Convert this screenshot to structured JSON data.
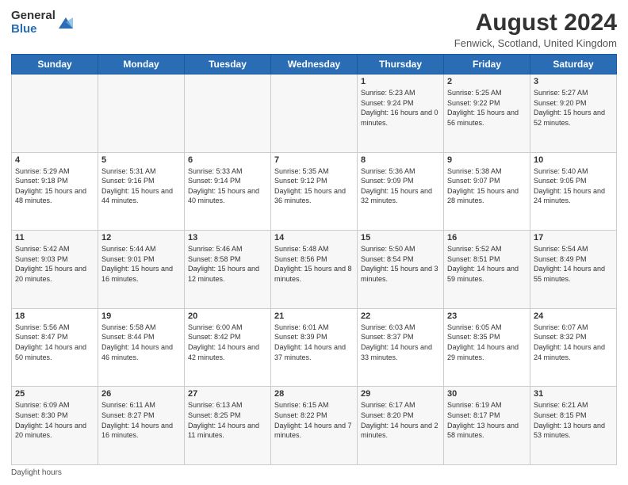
{
  "header": {
    "logo_general": "General",
    "logo_blue": "Blue",
    "title": "August 2024",
    "subtitle": "Fenwick, Scotland, United Kingdom"
  },
  "days_of_week": [
    "Sunday",
    "Monday",
    "Tuesday",
    "Wednesday",
    "Thursday",
    "Friday",
    "Saturday"
  ],
  "weeks": [
    [
      {
        "day": "",
        "info": ""
      },
      {
        "day": "",
        "info": ""
      },
      {
        "day": "",
        "info": ""
      },
      {
        "day": "",
        "info": ""
      },
      {
        "day": "1",
        "info": "Sunrise: 5:23 AM\nSunset: 9:24 PM\nDaylight: 16 hours\nand 0 minutes."
      },
      {
        "day": "2",
        "info": "Sunrise: 5:25 AM\nSunset: 9:22 PM\nDaylight: 15 hours\nand 56 minutes."
      },
      {
        "day": "3",
        "info": "Sunrise: 5:27 AM\nSunset: 9:20 PM\nDaylight: 15 hours\nand 52 minutes."
      }
    ],
    [
      {
        "day": "4",
        "info": "Sunrise: 5:29 AM\nSunset: 9:18 PM\nDaylight: 15 hours\nand 48 minutes."
      },
      {
        "day": "5",
        "info": "Sunrise: 5:31 AM\nSunset: 9:16 PM\nDaylight: 15 hours\nand 44 minutes."
      },
      {
        "day": "6",
        "info": "Sunrise: 5:33 AM\nSunset: 9:14 PM\nDaylight: 15 hours\nand 40 minutes."
      },
      {
        "day": "7",
        "info": "Sunrise: 5:35 AM\nSunset: 9:12 PM\nDaylight: 15 hours\nand 36 minutes."
      },
      {
        "day": "8",
        "info": "Sunrise: 5:36 AM\nSunset: 9:09 PM\nDaylight: 15 hours\nand 32 minutes."
      },
      {
        "day": "9",
        "info": "Sunrise: 5:38 AM\nSunset: 9:07 PM\nDaylight: 15 hours\nand 28 minutes."
      },
      {
        "day": "10",
        "info": "Sunrise: 5:40 AM\nSunset: 9:05 PM\nDaylight: 15 hours\nand 24 minutes."
      }
    ],
    [
      {
        "day": "11",
        "info": "Sunrise: 5:42 AM\nSunset: 9:03 PM\nDaylight: 15 hours\nand 20 minutes."
      },
      {
        "day": "12",
        "info": "Sunrise: 5:44 AM\nSunset: 9:01 PM\nDaylight: 15 hours\nand 16 minutes."
      },
      {
        "day": "13",
        "info": "Sunrise: 5:46 AM\nSunset: 8:58 PM\nDaylight: 15 hours\nand 12 minutes."
      },
      {
        "day": "14",
        "info": "Sunrise: 5:48 AM\nSunset: 8:56 PM\nDaylight: 15 hours\nand 8 minutes."
      },
      {
        "day": "15",
        "info": "Sunrise: 5:50 AM\nSunset: 8:54 PM\nDaylight: 15 hours\nand 3 minutes."
      },
      {
        "day": "16",
        "info": "Sunrise: 5:52 AM\nSunset: 8:51 PM\nDaylight: 14 hours\nand 59 minutes."
      },
      {
        "day": "17",
        "info": "Sunrise: 5:54 AM\nSunset: 8:49 PM\nDaylight: 14 hours\nand 55 minutes."
      }
    ],
    [
      {
        "day": "18",
        "info": "Sunrise: 5:56 AM\nSunset: 8:47 PM\nDaylight: 14 hours\nand 50 minutes."
      },
      {
        "day": "19",
        "info": "Sunrise: 5:58 AM\nSunset: 8:44 PM\nDaylight: 14 hours\nand 46 minutes."
      },
      {
        "day": "20",
        "info": "Sunrise: 6:00 AM\nSunset: 8:42 PM\nDaylight: 14 hours\nand 42 minutes."
      },
      {
        "day": "21",
        "info": "Sunrise: 6:01 AM\nSunset: 8:39 PM\nDaylight: 14 hours\nand 37 minutes."
      },
      {
        "day": "22",
        "info": "Sunrise: 6:03 AM\nSunset: 8:37 PM\nDaylight: 14 hours\nand 33 minutes."
      },
      {
        "day": "23",
        "info": "Sunrise: 6:05 AM\nSunset: 8:35 PM\nDaylight: 14 hours\nand 29 minutes."
      },
      {
        "day": "24",
        "info": "Sunrise: 6:07 AM\nSunset: 8:32 PM\nDaylight: 14 hours\nand 24 minutes."
      }
    ],
    [
      {
        "day": "25",
        "info": "Sunrise: 6:09 AM\nSunset: 8:30 PM\nDaylight: 14 hours\nand 20 minutes."
      },
      {
        "day": "26",
        "info": "Sunrise: 6:11 AM\nSunset: 8:27 PM\nDaylight: 14 hours\nand 16 minutes."
      },
      {
        "day": "27",
        "info": "Sunrise: 6:13 AM\nSunset: 8:25 PM\nDaylight: 14 hours\nand 11 minutes."
      },
      {
        "day": "28",
        "info": "Sunrise: 6:15 AM\nSunset: 8:22 PM\nDaylight: 14 hours\nand 7 minutes."
      },
      {
        "day": "29",
        "info": "Sunrise: 6:17 AM\nSunset: 8:20 PM\nDaylight: 14 hours\nand 2 minutes."
      },
      {
        "day": "30",
        "info": "Sunrise: 6:19 AM\nSunset: 8:17 PM\nDaylight: 13 hours\nand 58 minutes."
      },
      {
        "day": "31",
        "info": "Sunrise: 6:21 AM\nSunset: 8:15 PM\nDaylight: 13 hours\nand 53 minutes."
      }
    ]
  ],
  "footer": {
    "daylight_label": "Daylight hours"
  }
}
